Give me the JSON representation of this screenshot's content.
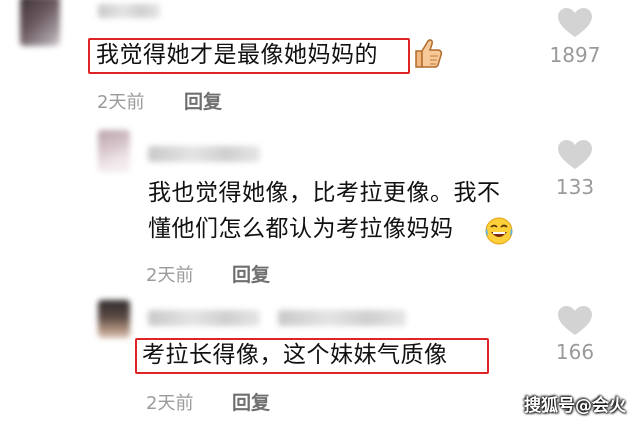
{
  "comments": [
    {
      "text": "我觉得她才是最像她妈妈的",
      "time": "2天前",
      "reply": "回复",
      "likes": "1897",
      "highlighted": true,
      "emoji": "thumbs-up"
    },
    {
      "text_line1": "我也觉得她像，比考拉更像。我不",
      "text_line2": "懂他们怎么都认为考拉像妈妈",
      "time": "2天前",
      "reply": "回复",
      "likes": "133",
      "highlighted": false,
      "emoji": "laughing-crying"
    },
    {
      "text": "考拉长得像，这个妹妹气质像",
      "time": "2天前",
      "reply": "回复",
      "likes": "166",
      "highlighted": true
    }
  ],
  "watermark": "搜狐号@会火",
  "colors": {
    "highlight_border": "#e02323",
    "like_icon": "#d3d3d3",
    "meta_text": "#9b9b9b"
  }
}
